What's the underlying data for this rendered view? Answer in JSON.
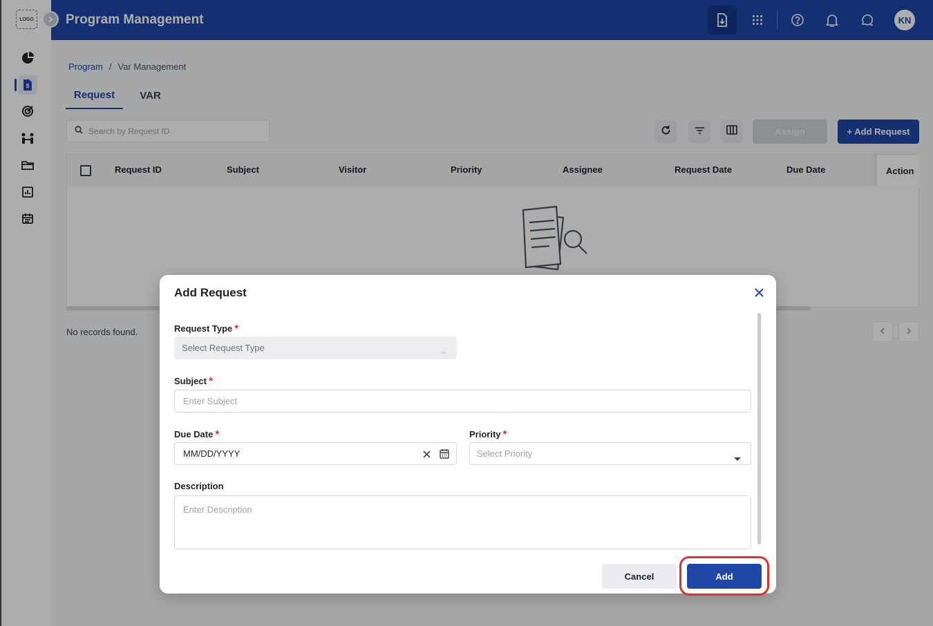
{
  "sidebar": {
    "logo_text": "LOGO",
    "items": [
      {
        "name": "pie-chart-icon"
      },
      {
        "name": "invoice-icon"
      },
      {
        "name": "target-icon"
      },
      {
        "name": "team-icon"
      },
      {
        "name": "folder-icon"
      },
      {
        "name": "report-icon"
      },
      {
        "name": "calendar-icon"
      }
    ]
  },
  "header": {
    "title": "Program Management",
    "avatar_initials": "KN",
    "icons": [
      "download-icon",
      "apps-grid-icon",
      "help-icon",
      "bell-icon",
      "chat-icon"
    ]
  },
  "breadcrumb": {
    "parent": "Program",
    "separator": "/",
    "current": "Var Management"
  },
  "tabs": {
    "request": "Request",
    "var": "VAR"
  },
  "toolbar": {
    "search_placeholder": "Search by Request ID",
    "assign_label": "Assign",
    "add_request_label": "+ Add Request"
  },
  "table": {
    "columns": [
      "Request ID",
      "Subject",
      "Visitor",
      "Priority",
      "Assignee",
      "Request Date",
      "Due Date"
    ],
    "action_column": "Action",
    "empty_message": "No records found."
  },
  "modal": {
    "title": "Add Request",
    "request_type_label": "Request Type",
    "request_type_placeholder": "Select Request Type",
    "subject_label": "Subject",
    "subject_placeholder": "Enter Subject",
    "due_date_label": "Due Date",
    "due_date_value": "MM/DD/YYYY",
    "priority_label": "Priority",
    "priority_placeholder": "Select Priority",
    "description_label": "Description",
    "description_placeholder": "Enter Description",
    "required_mark": "*",
    "cancel_label": "Cancel",
    "add_label": "Add"
  },
  "colors": {
    "brand": "#1e48a8",
    "required": "#d92d20",
    "highlight": "#e0312b"
  }
}
